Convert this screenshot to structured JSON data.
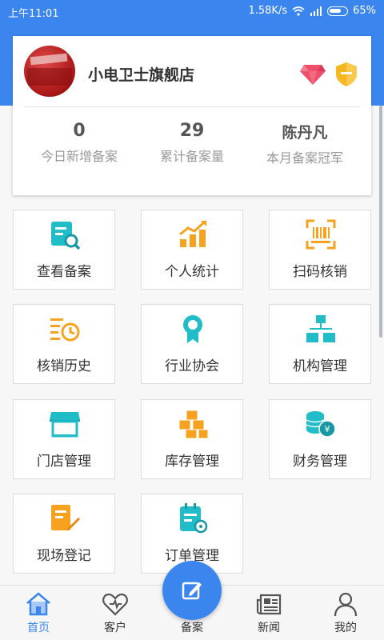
{
  "status_bar": {
    "time": "上午11:01",
    "speed": "1.58K/s",
    "battery": "65%"
  },
  "colors": {
    "primary": "#3b86ee",
    "teal": "#20bcc8",
    "orange": "#f6a21e",
    "red_badge": "#ef4f6b",
    "gold_badge": "#f5b61e"
  },
  "profile": {
    "store_name": "小电卫士旗舰店",
    "badges": [
      "gem-icon",
      "shield-icon"
    ]
  },
  "stats": [
    {
      "value": "0",
      "label": "今日新增备案"
    },
    {
      "value": "29",
      "label": "累计备案量"
    },
    {
      "value": "陈丹凡",
      "label": "本月备案冠军"
    }
  ],
  "tiles": [
    {
      "label": "查看备案",
      "icon": "view-record-icon"
    },
    {
      "label": "个人统计",
      "icon": "personal-stats-icon"
    },
    {
      "label": "扫码核销",
      "icon": "scan-code-icon"
    },
    {
      "label": "核销历史",
      "icon": "history-icon"
    },
    {
      "label": "行业协会",
      "icon": "association-icon"
    },
    {
      "label": "机构管理",
      "icon": "org-chart-icon"
    },
    {
      "label": "门店管理",
      "icon": "store-icon"
    },
    {
      "label": "库存管理",
      "icon": "inventory-icon"
    },
    {
      "label": "财务管理",
      "icon": "finance-icon"
    },
    {
      "label": "现场登记",
      "icon": "onsite-register-icon"
    },
    {
      "label": "订单管理",
      "icon": "order-icon"
    }
  ],
  "bottom_nav": [
    {
      "label": "首页",
      "icon": "home-icon",
      "active": true
    },
    {
      "label": "客户",
      "icon": "customer-icon",
      "active": false
    },
    {
      "label": "备案",
      "icon": "edit-icon",
      "active": false
    },
    {
      "label": "新闻",
      "icon": "news-icon",
      "active": false
    },
    {
      "label": "我的",
      "icon": "profile-icon",
      "active": false
    }
  ]
}
